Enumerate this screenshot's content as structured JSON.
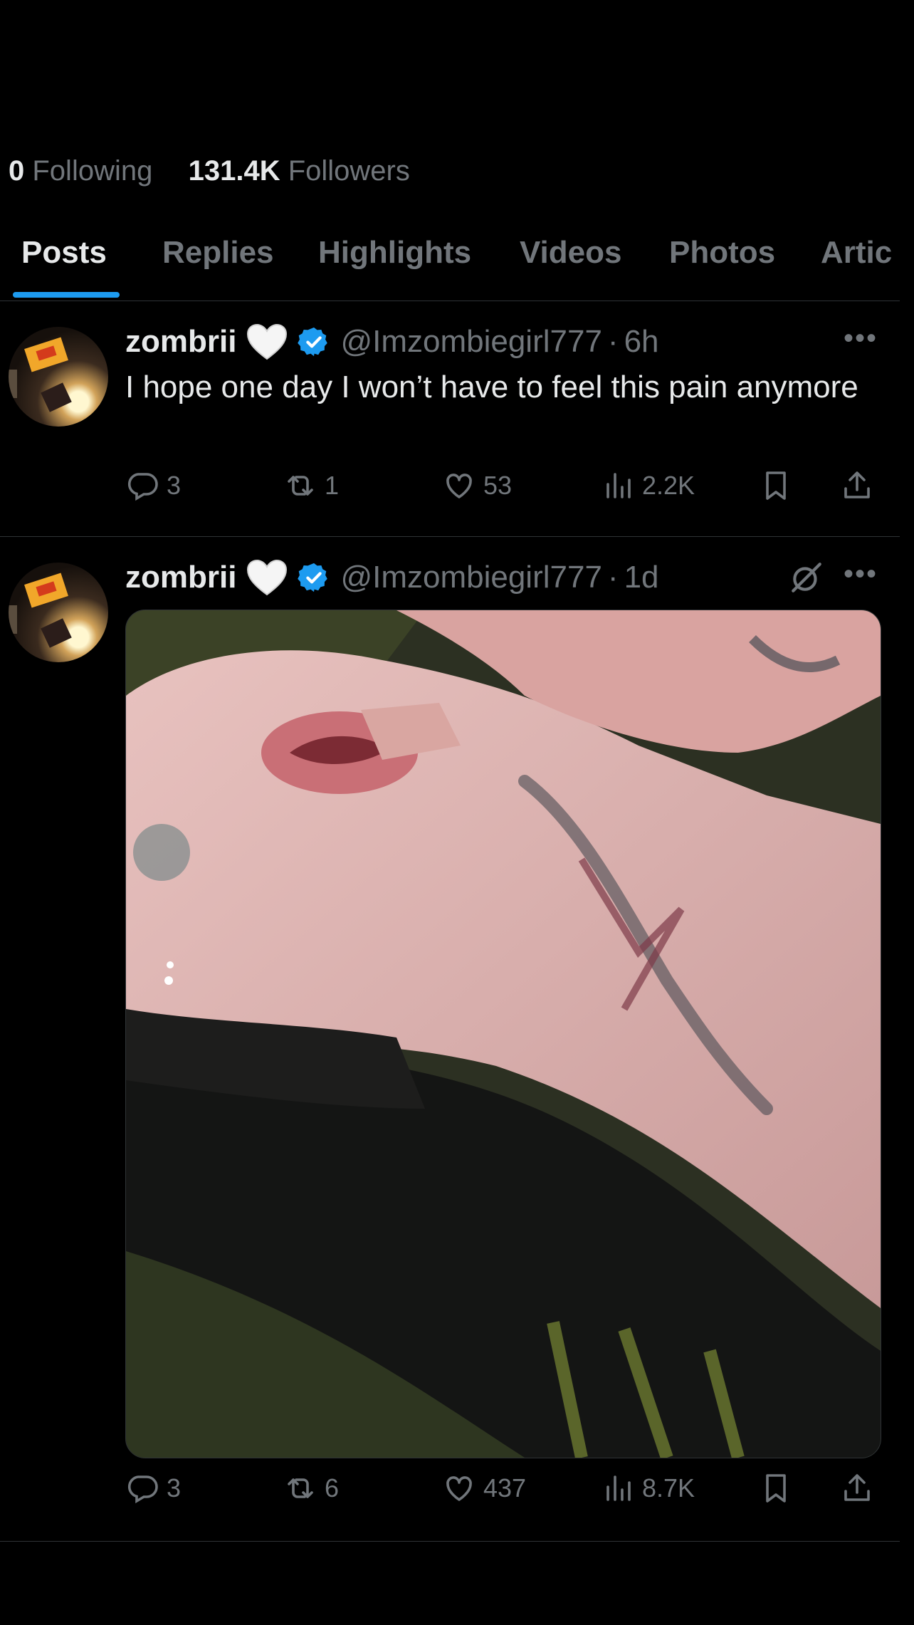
{
  "profile_stats": {
    "following_count": "0",
    "following_label": "Following",
    "followers_count": "131.4K",
    "followers_label": "Followers"
  },
  "tabs": [
    {
      "label": "Posts",
      "active": true
    },
    {
      "label": "Replies"
    },
    {
      "label": "Highlights"
    },
    {
      "label": "Videos"
    },
    {
      "label": "Photos"
    },
    {
      "label": "Artic"
    }
  ],
  "posts": [
    {
      "name": "zombrii",
      "handle": "@Imzombiegirl777",
      "sep": "·",
      "time": "6h",
      "text": "I hope one day I won’t have to feel this pain anymore",
      "replies": "3",
      "reposts": "1",
      "likes": "53",
      "views": "2.2K"
    },
    {
      "name": "zombrii",
      "handle": "@Imzombiegirl777",
      "sep": "·",
      "time": "1d",
      "media": "photo",
      "replies": "3",
      "reposts": "6",
      "likes": "437",
      "views": "8.7K"
    }
  ],
  "colors": {
    "accent": "#1d9bf0",
    "muted": "#71767b",
    "text": "#e7e9ea",
    "divider": "#2f3336",
    "background": "#000000"
  },
  "icons": [
    "white-heart-emoji",
    "verified-badge-icon",
    "more-icon",
    "grok-icon",
    "reply-icon",
    "repost-icon",
    "like-icon",
    "views-icon",
    "bookmark-icon",
    "share-icon"
  ]
}
